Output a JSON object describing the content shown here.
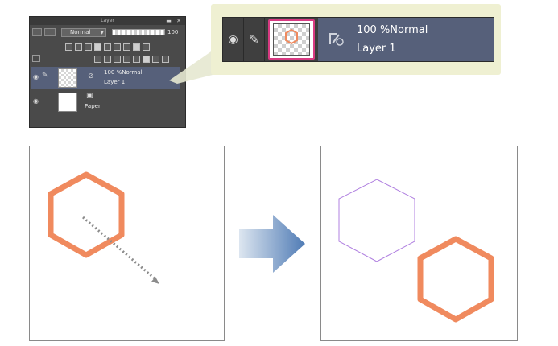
{
  "layer_panel": {
    "title": "Layer",
    "blend_mode": "Normal",
    "opacity": "100",
    "layers": [
      {
        "mode_line": "100 %Normal",
        "name": "Layer 1",
        "selected": true
      },
      {
        "mode_line": "",
        "name": "Paper",
        "selected": false
      }
    ]
  },
  "zoomed_layer": {
    "mode_line": "100 %Normal",
    "name": "Layer 1"
  },
  "colors": {
    "panel_bg": "#4a4a4a",
    "selected_row": "#56607a",
    "highlight_border": "#d83a82",
    "shape_orange": "#f08a5e",
    "shape_ghost": "#b080e0",
    "arrow_start": "#d8e2ee",
    "arrow_end": "#4f7bb5"
  },
  "icons": [
    "eye-icon",
    "pen-icon",
    "vector-layer-icon",
    "paper-icon",
    "move-arrow-icon",
    "right-arrow-icon"
  ]
}
